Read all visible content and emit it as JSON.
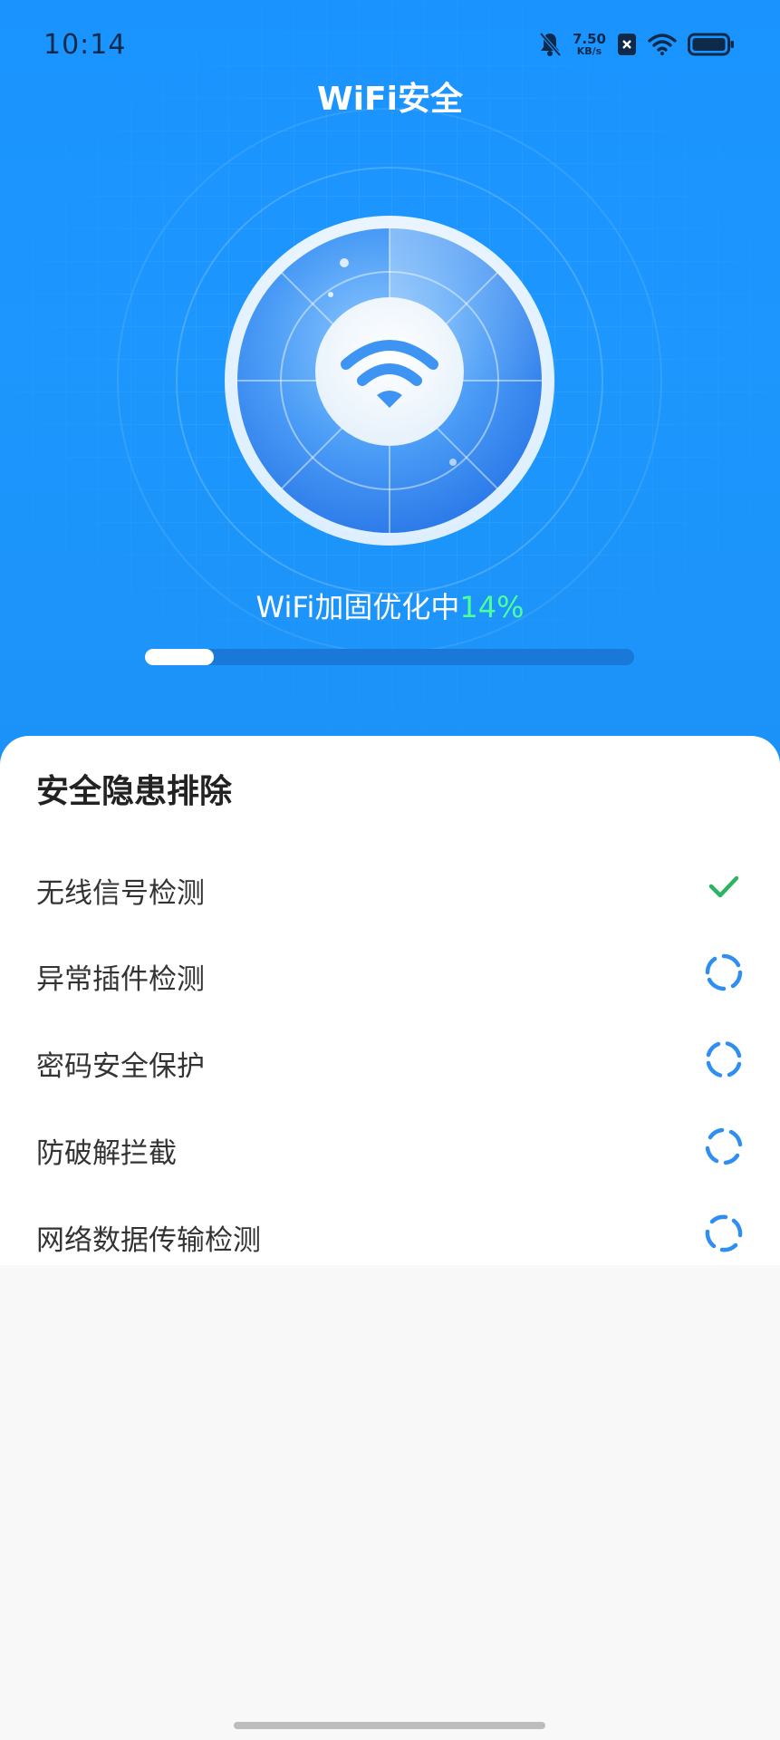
{
  "status_bar": {
    "time": "10:14",
    "speed_value": "7.50",
    "speed_unit": "KB/s"
  },
  "header": {
    "title": "WiFi安全"
  },
  "progress": {
    "label": "WiFi加固优化中",
    "percent_text": "14%",
    "value": 0.14
  },
  "colors": {
    "brand_blue": "#1d97fd",
    "accent_green": "#4dff9a",
    "check_green": "#2bb562",
    "spinner_blue": "#2f8ff0"
  },
  "sheet": {
    "title": "安全隐患排除",
    "items": [
      {
        "label": "无线信号检测",
        "status": "done",
        "status_icon": "check-icon"
      },
      {
        "label": "异常插件检测",
        "status": "pending",
        "status_icon": "loading-spinner-icon"
      },
      {
        "label": "密码安全保护",
        "status": "pending",
        "status_icon": "loading-spinner-icon"
      },
      {
        "label": "防破解拦截",
        "status": "pending",
        "status_icon": "loading-spinner-icon"
      },
      {
        "label": "网络数据传输检测",
        "status": "pending",
        "status_icon": "loading-spinner-icon"
      }
    ]
  }
}
